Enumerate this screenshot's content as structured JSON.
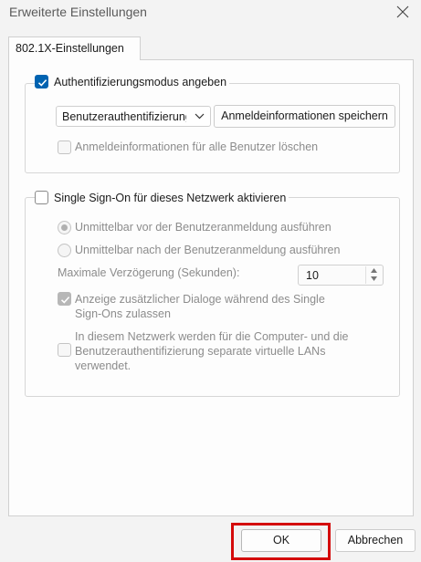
{
  "window": {
    "title": "Erweiterte Einstellungen"
  },
  "tab": {
    "label": "802.1X-Einstellungen"
  },
  "auth_group": {
    "checkbox_label": "Authentifizierungsmodus angeben",
    "checked": true,
    "mode_select": {
      "value": "Benutzerauthentifizierung"
    },
    "save_credentials_button": "Anmeldeinformationen speichern",
    "delete_credentials_label": "Anmeldeinformationen für alle Benutzer löschen"
  },
  "sso_group": {
    "checkbox_label": "Single Sign-On für dieses Netzwerk aktivieren",
    "checked": false,
    "radio_before": "Unmittelbar vor der Benutzeranmeldung ausführen",
    "radio_after": "Unmittelbar nach der Benutzeranmeldung ausführen",
    "max_delay_label": "Maximale Verzögerung (Sekunden):",
    "max_delay_value": "10",
    "additional_dialogs_line1": "Anzeige zusätzlicher Dialoge während des Single",
    "additional_dialogs_line2": "Sign-Ons zulassen",
    "vlan_line1": "In diesem Netzwerk werden für die Computer- und die",
    "vlan_line2": "Benutzerauthentifizierung separate virtuelle LANs",
    "vlan_line3": "verwendet."
  },
  "footer": {
    "ok_label": "OK",
    "cancel_label": "Abbrechen"
  },
  "colors": {
    "accent": "#0063b1",
    "highlight": "#d40a0a"
  }
}
